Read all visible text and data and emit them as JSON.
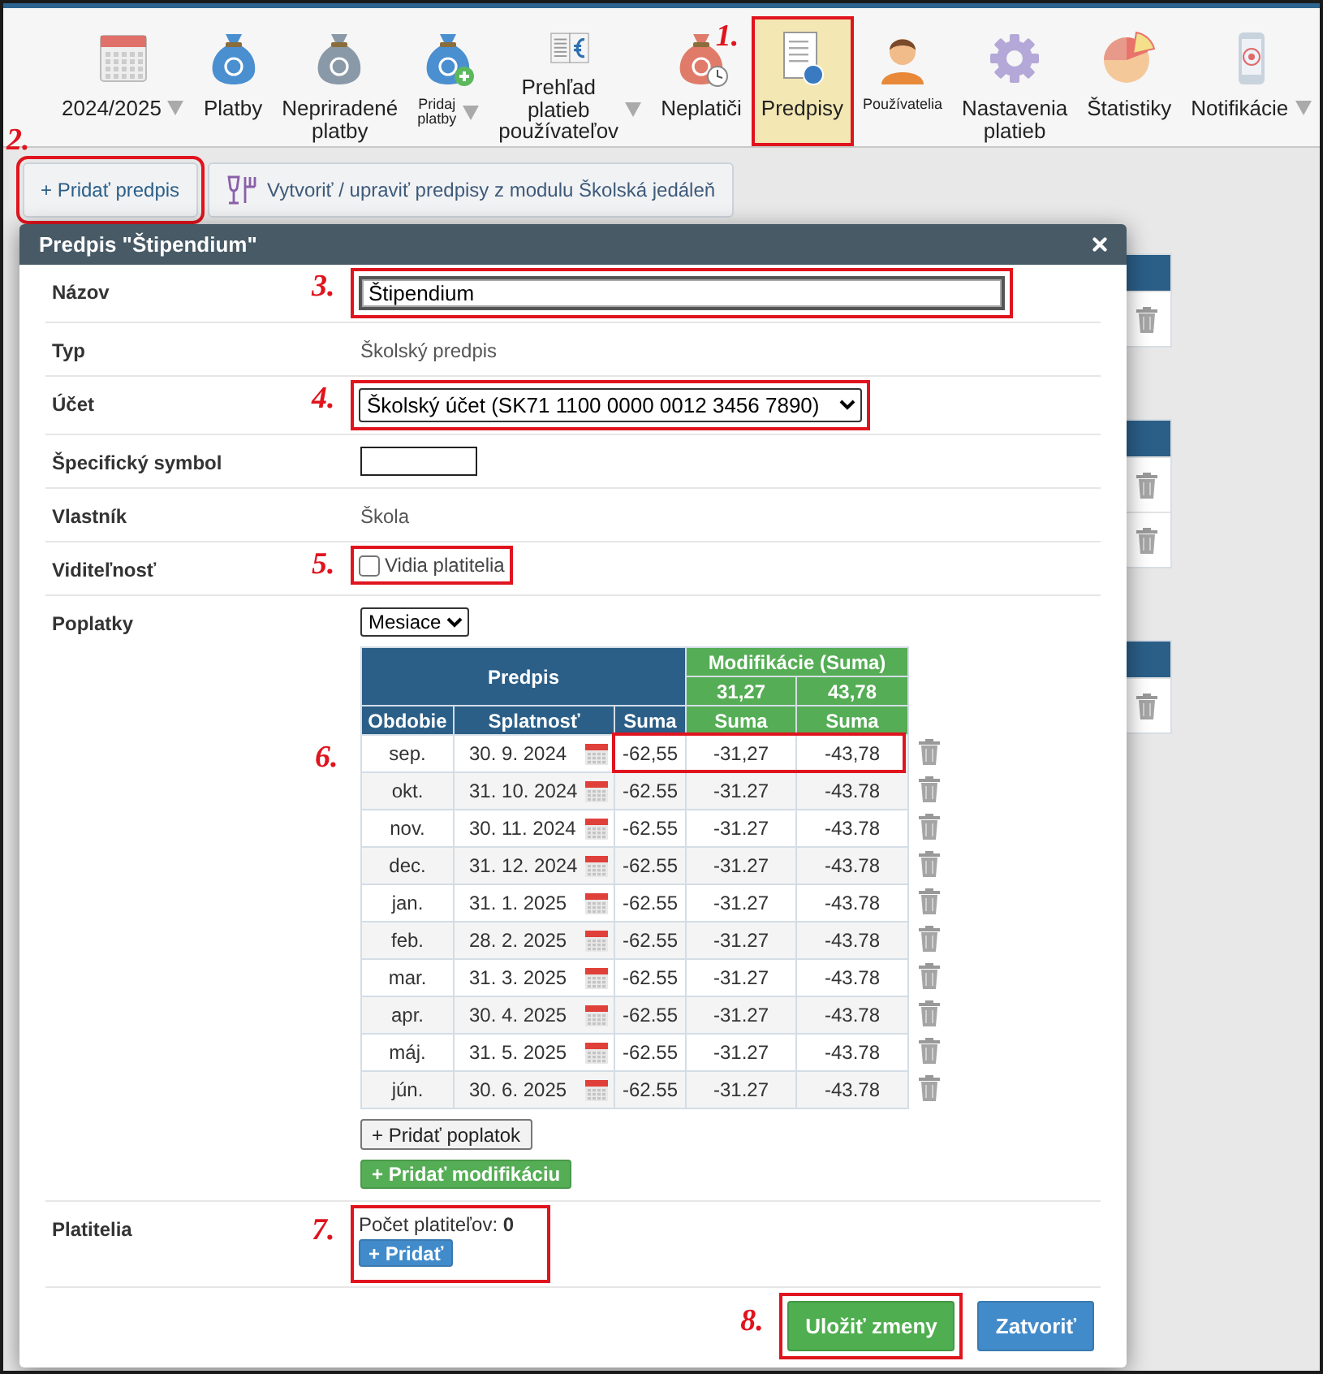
{
  "toolbar": {
    "items": [
      {
        "label": "2024/2025",
        "kind": "calendar",
        "dropdown": true,
        "small": false,
        "selected": false
      },
      {
        "label": "Platby",
        "kind": "bag",
        "dropdown": false,
        "small": false,
        "selected": false
      },
      {
        "label": "Nepriradené\nplatby",
        "kind": "bag-question",
        "dropdown": false,
        "small": false,
        "selected": false
      },
      {
        "label": "Pridaj platby",
        "kind": "bag-add",
        "dropdown": true,
        "small": true,
        "selected": false
      },
      {
        "label": "Prehľad platieb\npoužívateľov",
        "kind": "book",
        "dropdown": true,
        "small": false,
        "selected": false
      },
      {
        "label": "Neplatiči",
        "kind": "bag-clock",
        "dropdown": false,
        "small": false,
        "selected": false
      },
      {
        "label": "Predpisy",
        "kind": "document",
        "dropdown": false,
        "small": false,
        "selected": true,
        "marker": "1."
      },
      {
        "label": "Používatelia",
        "kind": "person",
        "dropdown": false,
        "small": true,
        "selected": false
      },
      {
        "label": "Nastavenia\nplatieb",
        "kind": "gear",
        "dropdown": false,
        "small": false,
        "selected": false
      },
      {
        "label": "Štatistiky",
        "kind": "pie",
        "dropdown": false,
        "small": false,
        "selected": false
      },
      {
        "label": "Notifikácie",
        "kind": "phone",
        "dropdown": true,
        "small": false,
        "selected": false
      }
    ]
  },
  "actions": [
    {
      "label": "+ Pridať predpis",
      "kind": "add",
      "marker": "2."
    },
    {
      "label": "Vytvoriť / upraviť predpisy z modulu Školská jedáleň",
      "kind": "canteen"
    }
  ],
  "dialog": {
    "title": "Predpis \"Štipendium\"",
    "fields": [
      {
        "kind": "input",
        "label": "Názov",
        "value": "Štipendium",
        "marker": "3."
      },
      {
        "kind": "text",
        "label": "Typ",
        "value": "Školský predpis"
      },
      {
        "kind": "select",
        "label": "Účet",
        "value": "Školský účet (SK71 1100 0000 0012 3456 7890)",
        "marker": "4."
      },
      {
        "kind": "short-input",
        "label": "Špecifický symbol"
      },
      {
        "kind": "text",
        "label": "Vlastník",
        "value": "Škola"
      },
      {
        "kind": "checkbox",
        "label": "Viditeľnosť",
        "option": "Vidia platitelia",
        "checked": false,
        "marker": "5."
      }
    ],
    "fees": {
      "label": "Poplatky",
      "period_select": "Mesiace",
      "group_header": "Predpis",
      "mod_header": "Modifikácie (Suma)",
      "mod_values": [
        "31,27",
        "43,78"
      ],
      "columns": [
        "Obdobie",
        "Splatnosť",
        "Suma",
        "Suma",
        "Suma"
      ],
      "rows": [
        {
          "period": "sep.",
          "due": "30. 9. 2024",
          "amount": "-62,55",
          "mods": [
            "-31,27",
            "-43,78"
          ],
          "marker": "6."
        },
        {
          "period": "okt.",
          "due": "31. 10. 2024",
          "amount": "-62.55",
          "mods": [
            "-31.27",
            "-43.78"
          ]
        },
        {
          "period": "nov.",
          "due": "30. 11. 2024",
          "amount": "-62.55",
          "mods": [
            "-31.27",
            "-43.78"
          ]
        },
        {
          "period": "dec.",
          "due": "31. 12. 2024",
          "amount": "-62.55",
          "mods": [
            "-31.27",
            "-43.78"
          ]
        },
        {
          "period": "jan.",
          "due": "31. 1. 2025",
          "amount": "-62.55",
          "mods": [
            "-31.27",
            "-43.78"
          ]
        },
        {
          "period": "feb.",
          "due": "28. 2. 2025",
          "amount": "-62.55",
          "mods": [
            "-31.27",
            "-43.78"
          ]
        },
        {
          "period": "mar.",
          "due": "31. 3. 2025",
          "amount": "-62.55",
          "mods": [
            "-31.27",
            "-43.78"
          ]
        },
        {
          "period": "apr.",
          "due": "30. 4. 2025",
          "amount": "-62.55",
          "mods": [
            "-31.27",
            "-43.78"
          ]
        },
        {
          "period": "máj.",
          "due": "31. 5. 2025",
          "amount": "-62.55",
          "mods": [
            "-31.27",
            "-43.78"
          ]
        },
        {
          "period": "jún.",
          "due": "30. 6. 2025",
          "amount": "-62.55",
          "mods": [
            "-31.27",
            "-43.78"
          ]
        }
      ],
      "add_fee": "+ Pridať poplatok",
      "add_modification": "+ Pridať modifikáciu"
    },
    "payers": {
      "label": "Platitelia",
      "count_label": "Počet platiteľov:",
      "count": "0",
      "add": "+ Pridať",
      "marker": "7."
    },
    "buttons": [
      {
        "label": "Uložiť zmeny",
        "kind": "primary",
        "marker": "8."
      },
      {
        "label": "Zatvoriť",
        "kind": "secondary"
      }
    ]
  }
}
